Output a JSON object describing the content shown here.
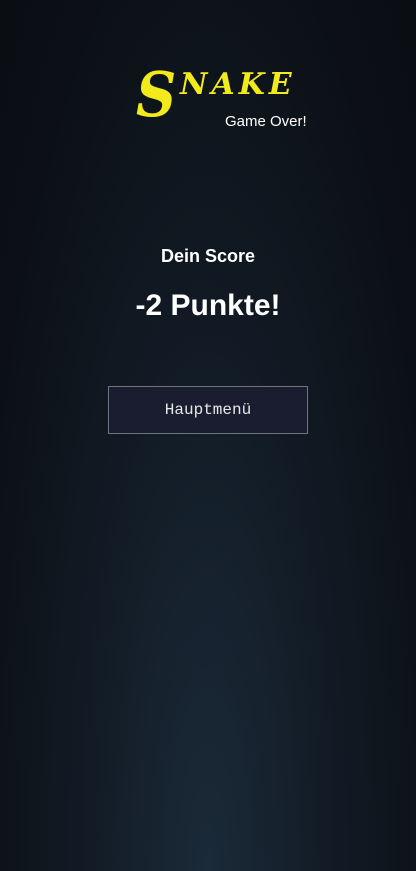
{
  "logo": {
    "first_letter": "S",
    "rest": "NAKE",
    "color": "#f2ea1a"
  },
  "subtitle": "Game Over!",
  "score": {
    "label": "Dein Score",
    "value": "-2 Punkte!"
  },
  "menu_button": {
    "label": "Hauptmenü"
  }
}
